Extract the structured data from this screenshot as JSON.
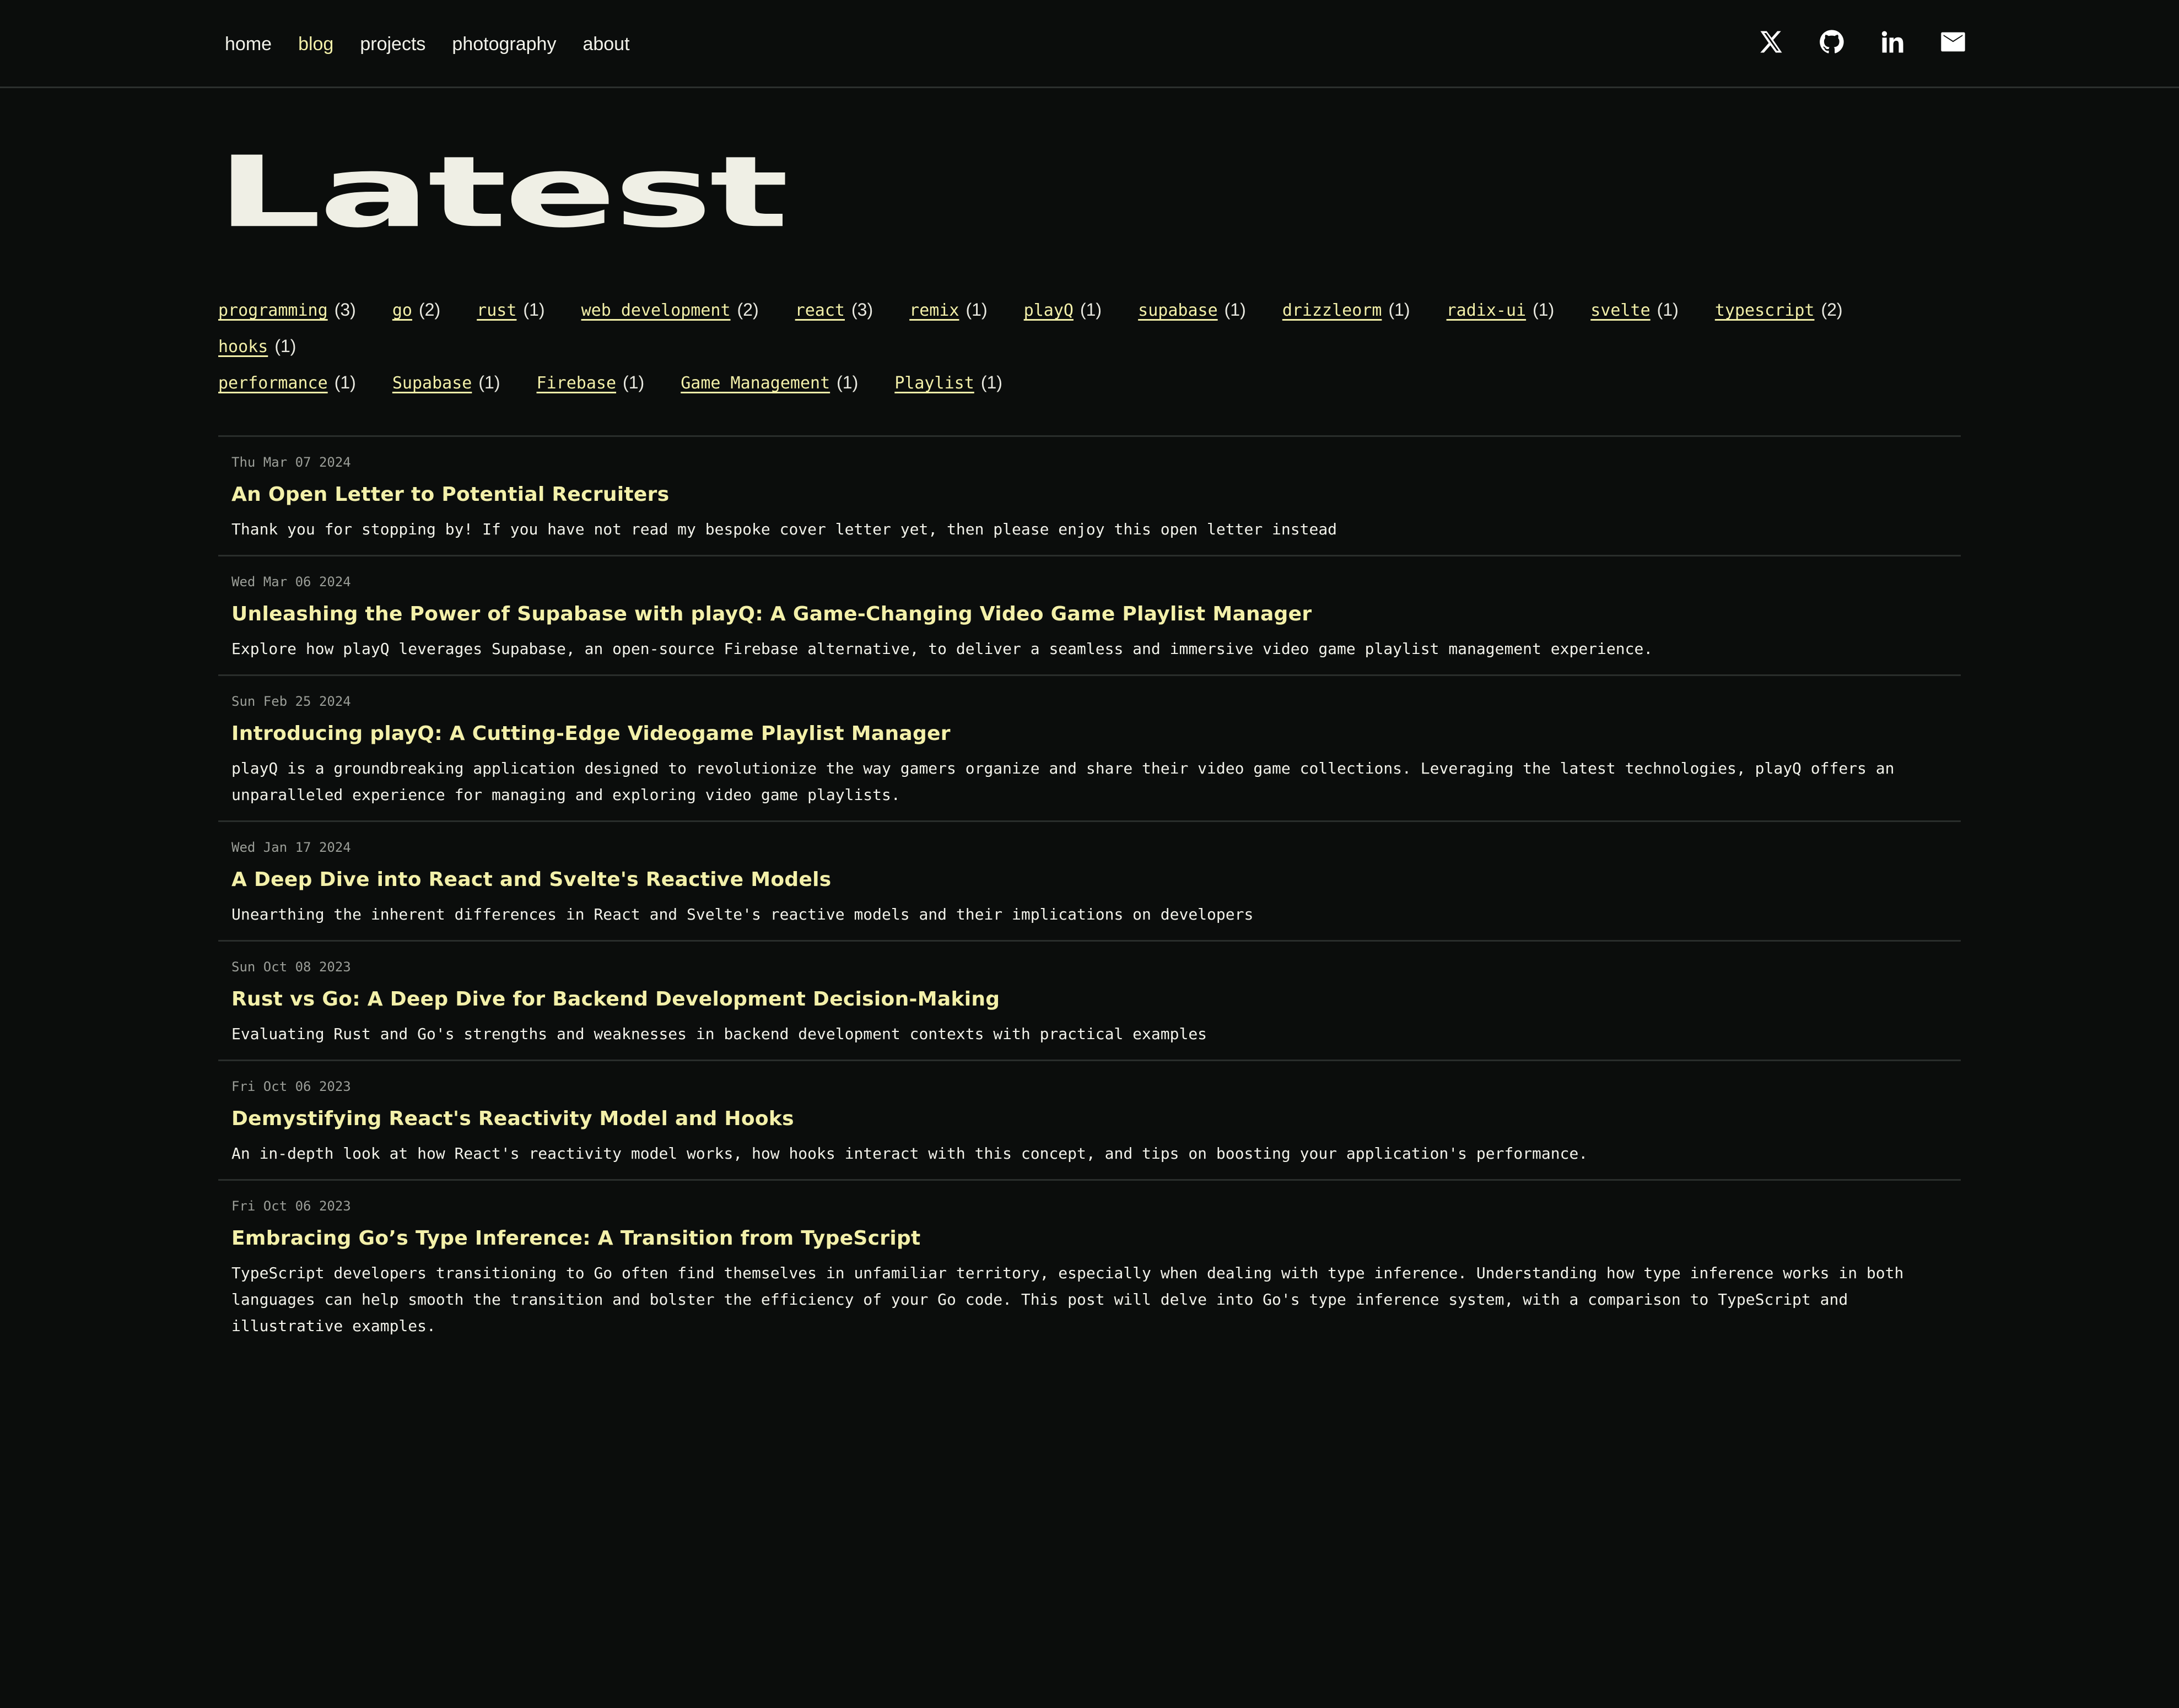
{
  "nav": {
    "links": [
      {
        "label": "home"
      },
      {
        "label": "blog"
      },
      {
        "label": "projects"
      },
      {
        "label": "photography"
      },
      {
        "label": "about"
      }
    ],
    "active": "blog",
    "socials": [
      "x-icon",
      "github-icon",
      "linkedin-icon",
      "mail-icon"
    ]
  },
  "hero": {
    "title": "Latest"
  },
  "tags": [
    {
      "name": "programming",
      "count": "(3)"
    },
    {
      "name": "go",
      "count": "(2)"
    },
    {
      "name": "rust",
      "count": "(1)"
    },
    {
      "name": "web development",
      "count": "(2)"
    },
    {
      "name": "react",
      "count": "(3)"
    },
    {
      "name": "remix",
      "count": "(1)"
    },
    {
      "name": "playQ",
      "count": "(1)"
    },
    {
      "name": "supabase",
      "count": "(1)"
    },
    {
      "name": "drizzleorm",
      "count": "(1)"
    },
    {
      "name": "radix-ui",
      "count": "(1)"
    },
    {
      "name": "svelte",
      "count": "(1)"
    },
    {
      "name": "typescript",
      "count": "(2)"
    },
    {
      "name": "hooks",
      "count": "(1)"
    },
    {
      "name": "performance",
      "count": "(1)"
    },
    {
      "name": "Supabase",
      "count": "(1)"
    },
    {
      "name": "Firebase",
      "count": "(1)"
    },
    {
      "name": "Game Management",
      "count": "(1)"
    },
    {
      "name": "Playlist",
      "count": "(1)"
    }
  ],
  "posts": [
    {
      "date": "Thu Mar 07 2024",
      "title": "An Open Letter to Potential Recruiters",
      "desc": "Thank you for stopping by! If you have not read my bespoke cover letter yet, then please enjoy this open letter instead"
    },
    {
      "date": "Wed Mar 06 2024",
      "title": "Unleashing the Power of Supabase with playQ: A Game-Changing Video Game Playlist Manager",
      "desc": "Explore how playQ leverages Supabase, an open-source Firebase alternative, to deliver a seamless and immersive video game playlist management experience."
    },
    {
      "date": "Sun Feb 25 2024",
      "title": "Introducing playQ: A Cutting-Edge Videogame Playlist Manager",
      "desc": "playQ is a groundbreaking application designed to revolutionize the way gamers organize and share their video game collections. Leveraging the latest technologies, playQ offers an unparalleled experience for managing and exploring video game playlists."
    },
    {
      "date": "Wed Jan 17 2024",
      "title": "A Deep Dive into React and Svelte's Reactive Models",
      "desc": "Unearthing the inherent differences in React and Svelte's reactive models and their implications on developers"
    },
    {
      "date": "Sun Oct 08 2023",
      "title": "Rust vs Go: A Deep Dive for Backend Development Decision-Making",
      "desc": "Evaluating Rust and Go's strengths and weaknesses in backend development contexts with practical examples"
    },
    {
      "date": "Fri Oct 06 2023",
      "title": "Demystifying React's Reactivity Model and Hooks",
      "desc": "An in-depth look at how React's reactivity model works, how hooks interact with this concept, and tips on boosting your application's performance."
    },
    {
      "date": "Fri Oct 06 2023",
      "title": "Embracing Go’s Type Inference: A Transition from TypeScript",
      "desc": "TypeScript developers transitioning to Go often find themselves in unfamiliar territory, especially when dealing with type inference. Understanding how type inference works in both languages can help smooth the transition and bolster the efficiency of your Go code. This post will delve into Go's type inference system, with a comparison to TypeScript and illustrative examples."
    }
  ],
  "colors": {
    "background": "#0b0d0c",
    "accent": "#f3f0a9",
    "text": "#f2f2ea",
    "muted": "#9b9e98",
    "divider": "#2a2e2c"
  }
}
